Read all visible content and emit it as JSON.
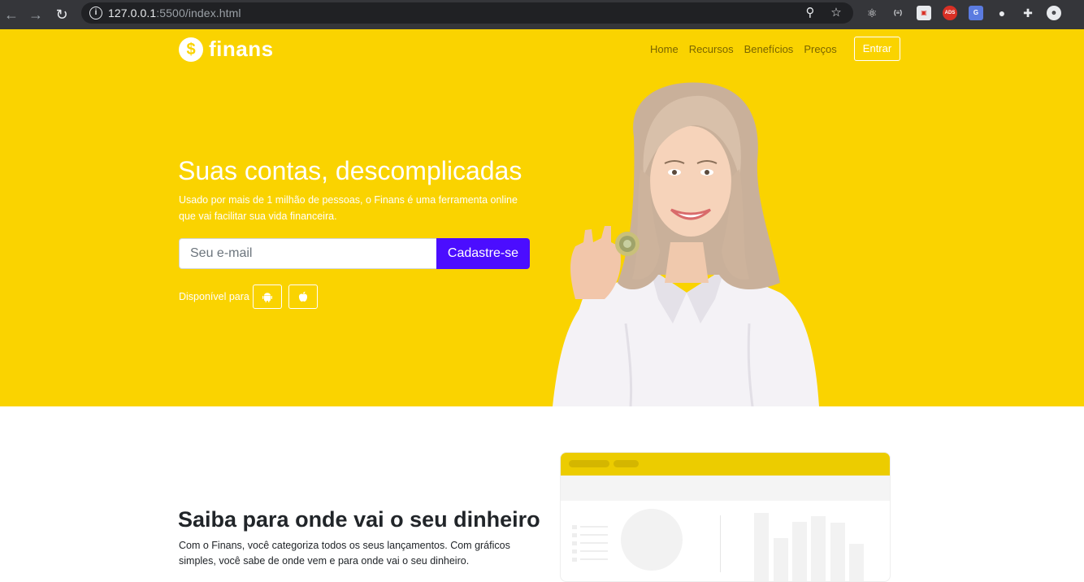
{
  "browser": {
    "url_host": "127.0.0.1",
    "url_rest": ":5500/index.html",
    "ext_ads": "ADS"
  },
  "header": {
    "brand": "finans",
    "brand_symbol": "$",
    "nav": [
      "Home",
      "Recursos",
      "Benefícios",
      "Preços"
    ],
    "login": "Entrar"
  },
  "hero": {
    "title": "Suas contas, descomplicadas",
    "subtitle": "Usado por mais de 1 milhão de pessoas, o Finans é uma ferramenta online que vai facilitar sua vida financeira.",
    "email_placeholder": "Seu e-mail",
    "cta": "Cadastre-se",
    "available": "Disponível para"
  },
  "feature": {
    "title": "Saiba para onde vai o seu dinheiro",
    "text": "Com o Finans, você categoriza todos os seus lançamentos. Com gráficos simples, você sabe de onde vem e para onde vai o seu dinheiro."
  },
  "colors": {
    "brand_yellow": "#fad300",
    "cta_purple": "#4b0dff"
  }
}
